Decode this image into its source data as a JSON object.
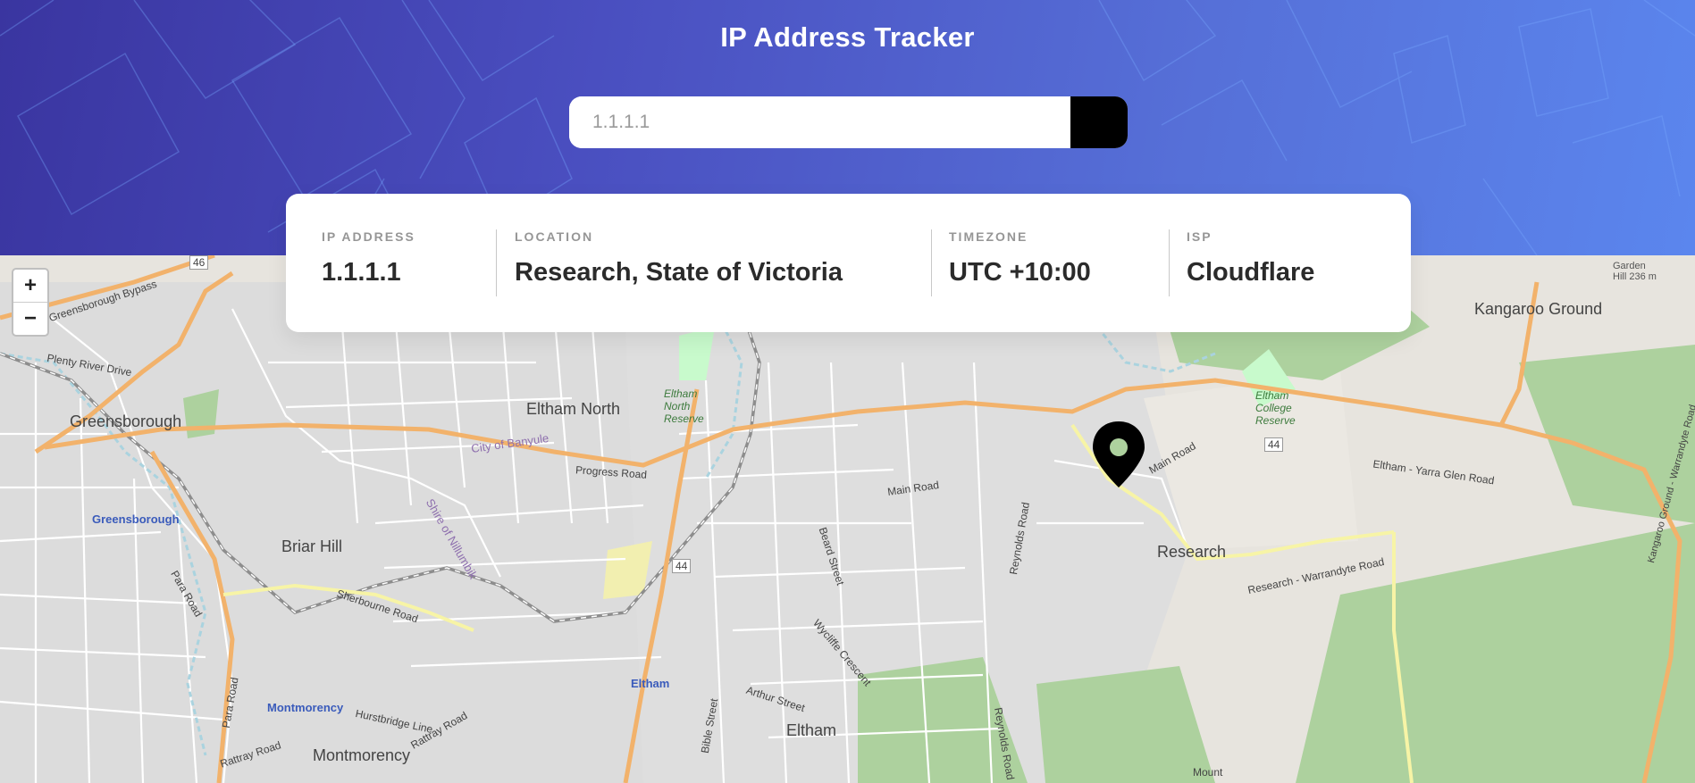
{
  "header": {
    "title": "IP Address Tracker",
    "search": {
      "placeholder": "1.1.1.1",
      "value": ""
    },
    "submit_icon": "chevron-right-icon"
  },
  "info": {
    "ip_label": "IP ADDRESS",
    "ip_value": "1.1.1.1",
    "location_label": "LOCATION",
    "location_value": "Research, State of Victoria",
    "timezone_label": "TIMEZONE",
    "timezone_value": "UTC +10:00",
    "isp_label": "ISP",
    "isp_value": "Cloudflare"
  },
  "map": {
    "zoom_in": "+",
    "zoom_out": "−",
    "marker_icon": "map-pin-icon",
    "labels": {
      "kangaroo_ground": "Kangaroo Ground",
      "garden_hill": "Garden Hill 236 m",
      "greensborough": "Greensborough",
      "greensborough_station": "Greensborough",
      "eltham_north": "Eltham North",
      "briar_hill": "Briar Hill",
      "research": "Research",
      "eltham": "Eltham",
      "eltham_station": "Eltham",
      "montmorency": "Montmorency",
      "montmorency_station": "Montmorency",
      "city_of_banyule": "City of Banyule",
      "shire_of_nillumbik": "Shire of Nillumbik",
      "eltham_north_reserve": "Eltham North Reserve",
      "eltham_college_reserve": "Eltham College Reserve",
      "progress_road": "Progress Road",
      "main_road": "Main Road",
      "main_road_2": "Main Road",
      "eltham_yarra_glen_road": "Eltham - Yarra Glen Road",
      "research_warrandyte_road": "Research - Warrandyte Road",
      "sherbourne_road": "Sherbourne Road",
      "greensborough_bypass": "Greensborough Bypass",
      "plenty_river_drive": "Plenty River Drive",
      "beard_street": "Beard Street",
      "wycliffe_crescent": "Wycliffe Crescent",
      "arthur_street": "Arthur Street",
      "bible_street": "Bible Street",
      "reynolds_road": "Reynolds Road",
      "reynolds_road_2": "Reynolds Road",
      "para_road": "Para Road",
      "para_road_2": "Para Road",
      "rattray_road": "Rattray Road",
      "rattray_road_2": "Rattray Road",
      "hurstbridge_line": "Hurstbridge Line",
      "kangaroo_ground_road": "Kangaroo Ground - Warrandyte Road",
      "mount": "Mount",
      "route_46": "46",
      "route_44": "44",
      "route_44_b": "44"
    }
  },
  "colors": {
    "header_start": "#3a35a0",
    "header_end": "#5b86ee",
    "button": "#000000",
    "value_text": "#2b2b2b",
    "label_text": "#969696"
  }
}
